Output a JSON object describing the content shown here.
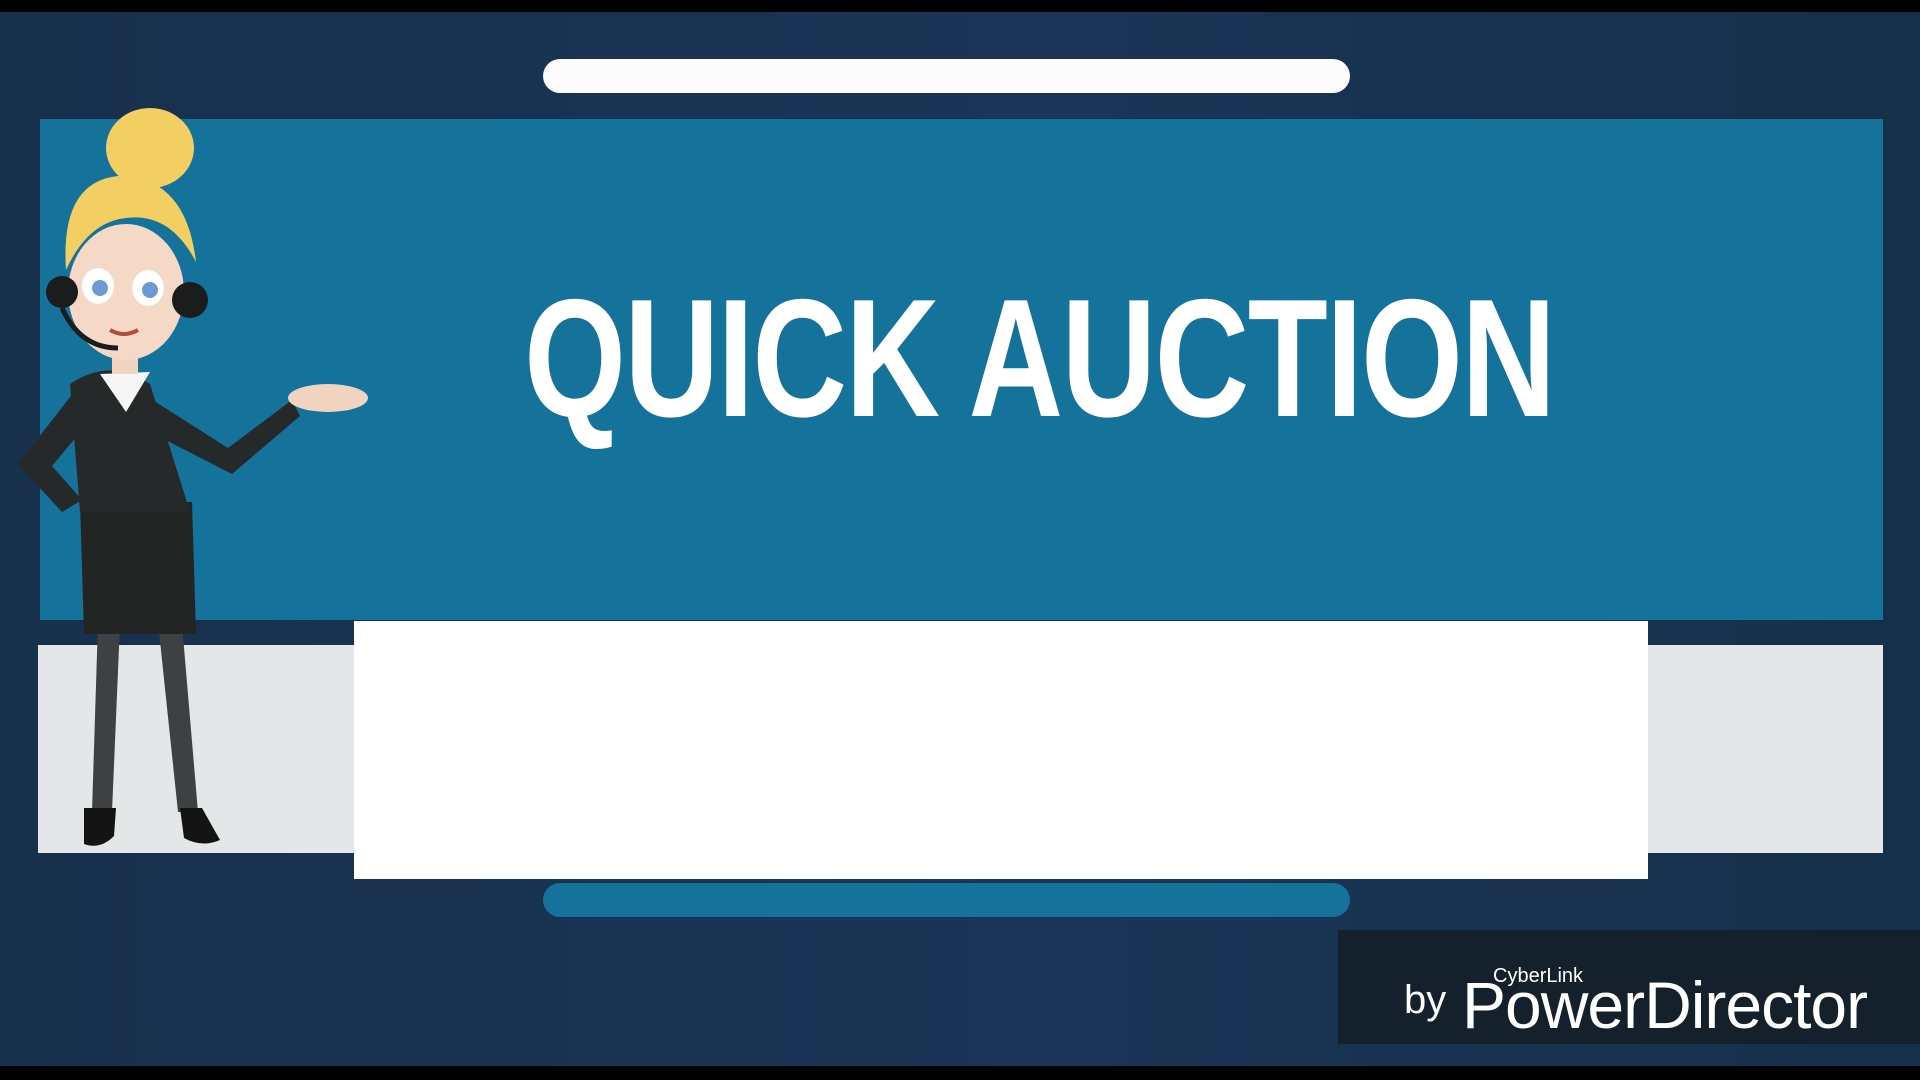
{
  "slide": {
    "title": "QUICK AUCTION"
  },
  "watermark": {
    "by": "by",
    "cyberlink": "CyberLink",
    "brand": "PowerDirector"
  },
  "colors": {
    "background": "#1a3556",
    "panel_blue": "#14729b",
    "panel_gray": "#e4e7e7",
    "title": "#ffffff",
    "accent_bar": "#15739b"
  },
  "icons": {
    "presenter": "presenter-woman-illustration"
  }
}
